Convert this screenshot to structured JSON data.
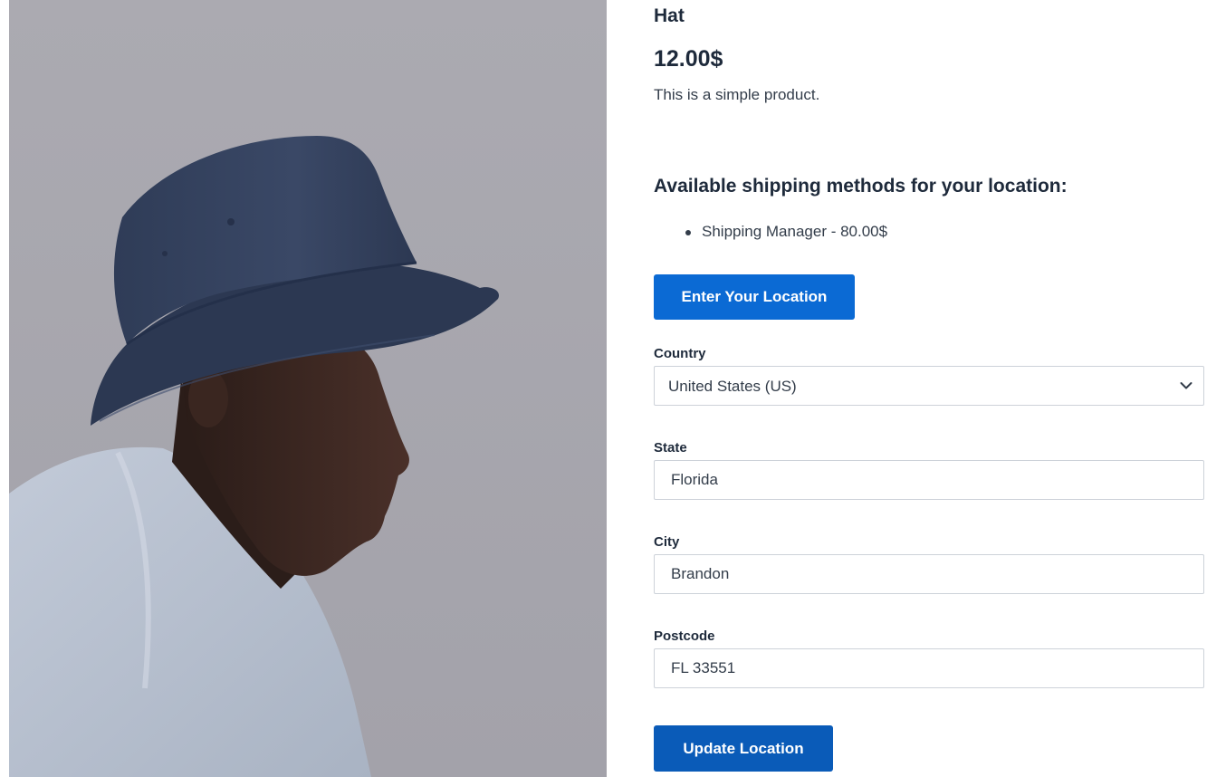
{
  "product": {
    "title": "Hat",
    "price": "12.00$",
    "description": "This is a simple product.",
    "image_icon": "product-photo"
  },
  "shipping": {
    "heading": "Available shipping methods for your location:",
    "methods": [
      "Shipping Manager - 80.00$"
    ]
  },
  "buttons": {
    "enter_location": "Enter Your Location",
    "update_location": "Update Location"
  },
  "form": {
    "country": {
      "label": "Country",
      "value": "United States (US)",
      "icon": "chevron-down-icon"
    },
    "state": {
      "label": "State",
      "value": "Florida"
    },
    "city": {
      "label": "City",
      "value": "Brandon"
    },
    "postcode": {
      "label": "Postcode",
      "value": "FL 33551"
    }
  },
  "colors": {
    "primary_button": "#0b6ad4",
    "update_button": "#0a5bb8",
    "text_dark": "#1e2a3b",
    "border": "#cdd2d9",
    "image_background": "#a7a6ae"
  }
}
